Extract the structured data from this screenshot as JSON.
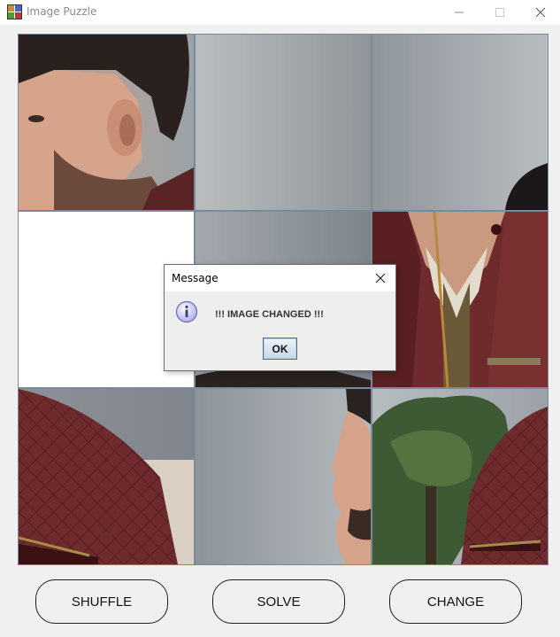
{
  "window": {
    "title": "Image Puzzle",
    "icons": [
      "puzzle-app-icon",
      "minimize-icon",
      "maximize-icon",
      "close-icon"
    ]
  },
  "board": {
    "rows": 3,
    "cols": 3,
    "empty_tile": {
      "row": 2,
      "col": 1
    },
    "tiles": [
      {
        "row": 1,
        "col": 1,
        "content": "face-left-ear"
      },
      {
        "row": 1,
        "col": 2,
        "content": "grey-background"
      },
      {
        "row": 1,
        "col": 3,
        "content": "grey-background-hair-tip"
      },
      {
        "row": 2,
        "col": 1,
        "content": "empty"
      },
      {
        "row": 2,
        "col": 2,
        "content": "grey-background-hair"
      },
      {
        "row": 2,
        "col": 3,
        "content": "jacket-collar-zipper"
      },
      {
        "row": 3,
        "col": 1,
        "content": "jacket-shoulder-quilted"
      },
      {
        "row": 3,
        "col": 2,
        "content": "face-profile"
      },
      {
        "row": 3,
        "col": 3,
        "content": "tree-and-shoulder"
      }
    ]
  },
  "controls": {
    "shuffle_label": "SHUFFLE",
    "solve_label": "SOLVE",
    "change_label": "CHANGE"
  },
  "dialog": {
    "title": "Message",
    "message": "!!! IMAGE CHANGED !!!",
    "ok_label": "OK",
    "icon": "information-icon"
  },
  "colors": {
    "window_bg": "#f0f0f0",
    "board_grid": "#7b8a99",
    "jacket": "#6e2a2c",
    "background_grey": "#a9afb5",
    "dialog_ok_border": "#4e6c8d"
  }
}
